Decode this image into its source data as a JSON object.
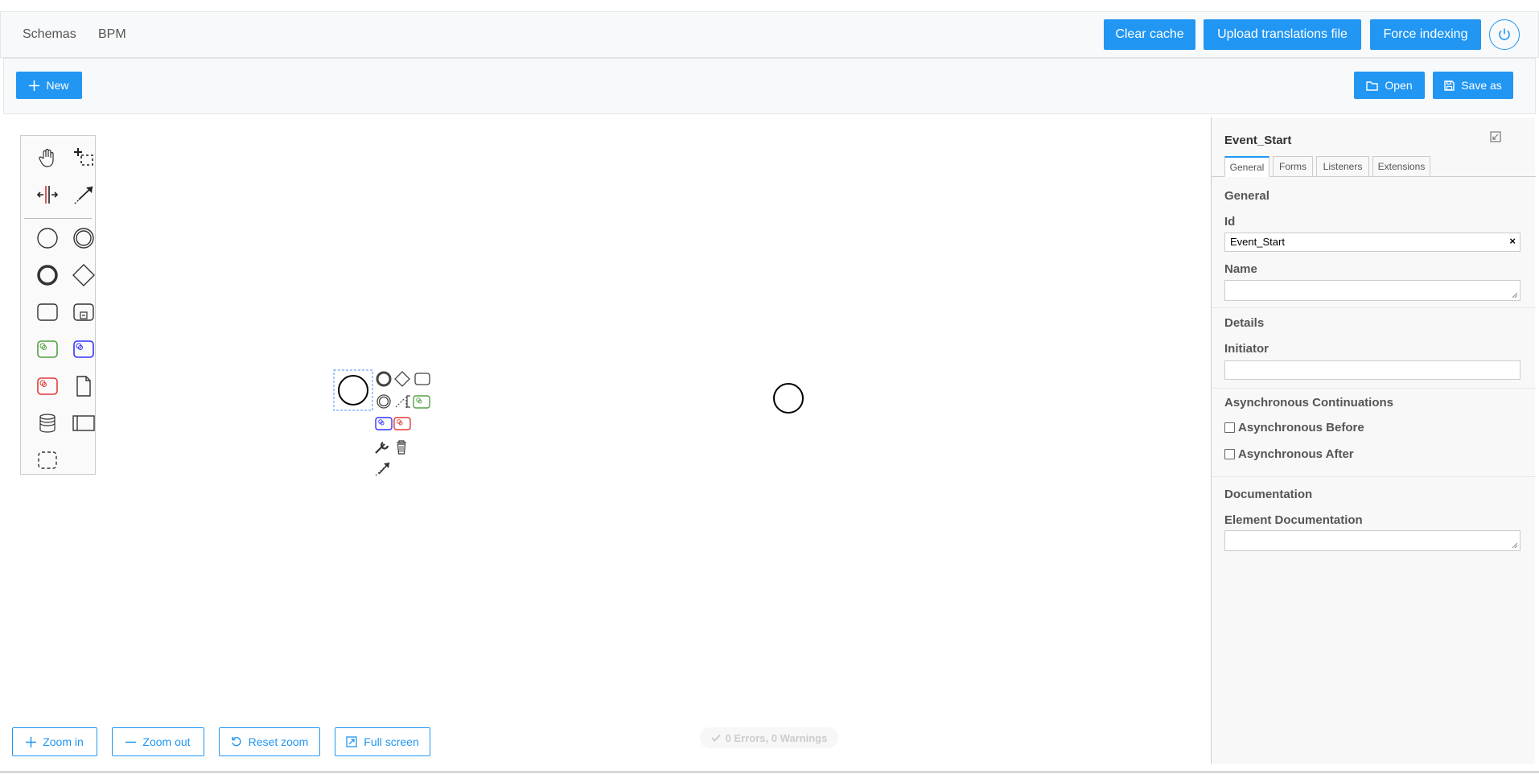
{
  "topnav": {
    "links": [
      "Schemas",
      "BPM"
    ],
    "clear_cache": "Clear cache",
    "upload_translations": "Upload translations file",
    "force_indexing": "Force indexing",
    "power_icon": "power-icon"
  },
  "toolbar": {
    "new_label": "New",
    "open_label": "Open",
    "save_as_label": "Save as"
  },
  "palette": {
    "tools": [
      "hand-tool-icon",
      "lasso-tool-icon",
      "space-tool-icon",
      "global-connect-icon",
      "start-event-icon",
      "intermediate-event-icon",
      "end-event-icon",
      "gateway-icon",
      "task-icon",
      "subprocess-icon",
      "green-task-icon",
      "blue-task-icon",
      "red-task-icon",
      "data-object-icon",
      "data-store-icon",
      "participant-icon",
      "group-icon"
    ]
  },
  "zoom": {
    "zoom_in": "Zoom in",
    "zoom_out": "Zoom out",
    "reset_zoom": "Reset zoom",
    "full_screen": "Full screen"
  },
  "status": {
    "text": "0 Errors, 0 Warnings"
  },
  "properties": {
    "title": "Event_Start",
    "tabs": [
      "General",
      "Forms",
      "Listeners",
      "Extensions"
    ],
    "general_group": "General",
    "id_label": "Id",
    "id_value": "Event_Start",
    "name_label": "Name",
    "name_value": "",
    "details_group": "Details",
    "initiator_label": "Initiator",
    "initiator_value": "",
    "async_group": "Asynchronous Continuations",
    "async_before": "Asynchronous Before",
    "async_after": "Asynchronous After",
    "doc_group": "Documentation",
    "element_doc_label": "Element Documentation",
    "element_doc_value": ""
  },
  "colors": {
    "accent": "#2196f3",
    "green_task": "#52a043",
    "blue_task": "#3333ff",
    "red_task": "#e53935"
  }
}
